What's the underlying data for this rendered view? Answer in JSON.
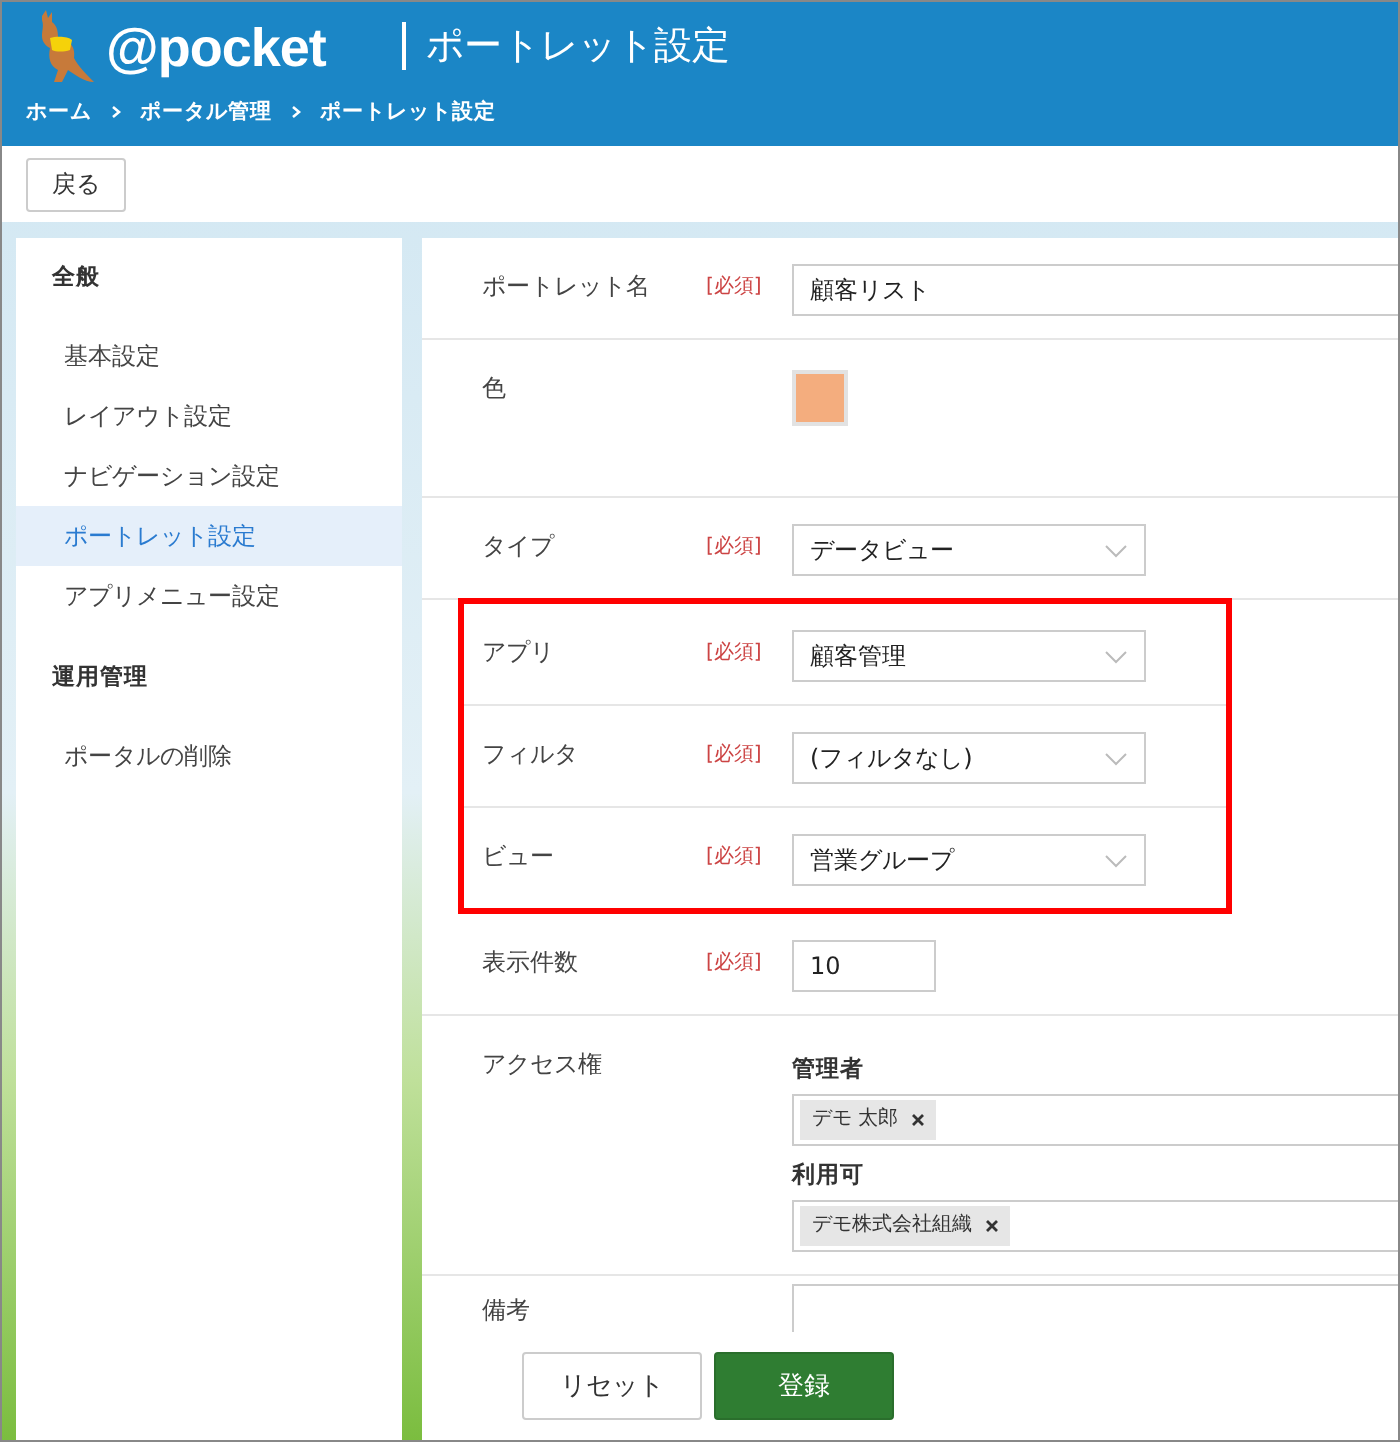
{
  "header": {
    "logo_text": "@pocket",
    "title": "ポートレット設定",
    "breadcrumb": [
      "ホーム",
      "ポータル管理",
      "ポートレット設定"
    ]
  },
  "toolbar": {
    "back_button": "戻る"
  },
  "sidebar": {
    "sections": [
      {
        "heading": "全般",
        "items": [
          {
            "label": "基本設定",
            "selected": false
          },
          {
            "label": "レイアウト設定",
            "selected": false
          },
          {
            "label": "ナビゲーション設定",
            "selected": false
          },
          {
            "label": "ポートレット設定",
            "selected": true
          },
          {
            "label": "アプリメニュー設定",
            "selected": false
          }
        ]
      },
      {
        "heading": "運用管理",
        "items": [
          {
            "label": "ポータルの削除",
            "selected": false
          }
        ]
      }
    ]
  },
  "form": {
    "fields": [
      {
        "kind": "text",
        "label": "ポートレット名",
        "required": "[必須]",
        "value": "顧客リスト",
        "highlighted": false
      },
      {
        "kind": "color",
        "label": "色",
        "color": "#f4ad7e",
        "highlighted": false
      },
      {
        "kind": "select",
        "label": "タイプ",
        "required": "[必須]",
        "value": "データビュー",
        "highlighted": false
      },
      {
        "kind": "select",
        "label": "アプリ",
        "required": "[必須]",
        "value": "顧客管理",
        "highlighted": true
      },
      {
        "kind": "select",
        "label": "フィルタ",
        "required": "[必須]",
        "value": "(フィルタなし)",
        "highlighted": true
      },
      {
        "kind": "select",
        "label": "ビュー",
        "required": "[必須]",
        "value": "営業グループ",
        "highlighted": true
      },
      {
        "kind": "number",
        "label": "表示件数",
        "required": "[必須]",
        "value": "10",
        "highlighted": false
      },
      {
        "kind": "access",
        "label": "アクセス権",
        "highlighted": false,
        "groups": [
          {
            "heading": "管理者",
            "tags": [
              "デモ 太郎"
            ]
          },
          {
            "heading": "利用可",
            "tags": [
              "デモ株式会社組織"
            ]
          }
        ]
      },
      {
        "kind": "textarea",
        "label": "備考",
        "highlighted": false
      }
    ]
  },
  "footer": {
    "reset_button": "リセット",
    "submit_button": "登録"
  }
}
